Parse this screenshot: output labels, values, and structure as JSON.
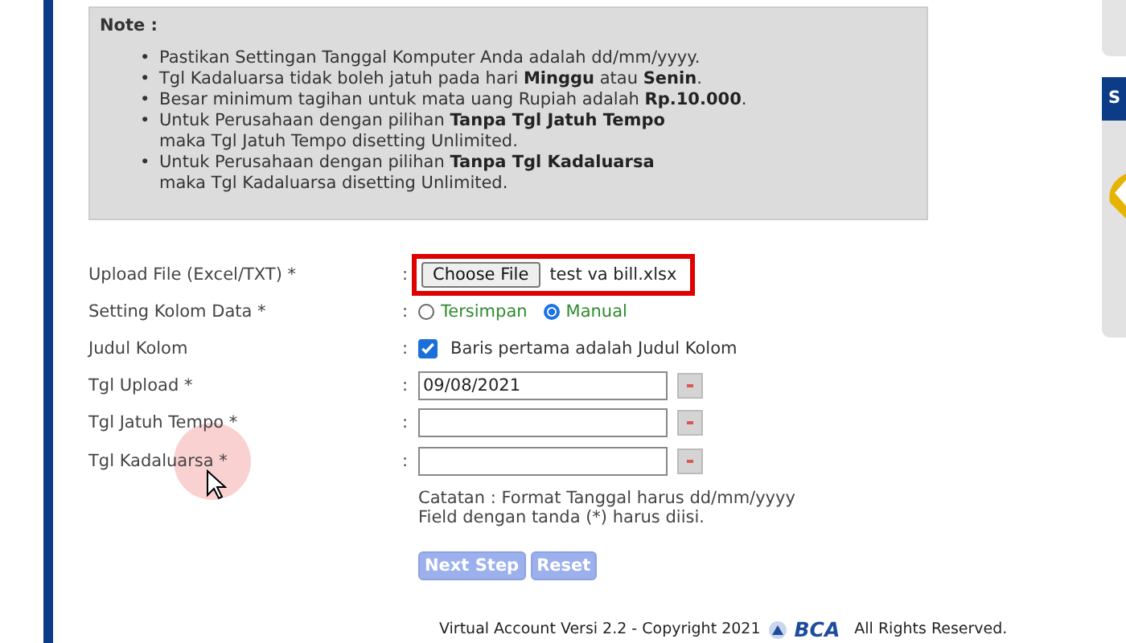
{
  "note": {
    "title": "Note :",
    "bullet": "•",
    "items": [
      {
        "text": "Pastikan Settingan Tanggal Komputer Anda adalah dd/mm/yyyy."
      },
      {
        "text": "Tgl Kadaluarsa tidak boleh jatuh pada hari **Minggu** atau **Senin**."
      },
      {
        "text": "Besar minimum tagihan untuk mata uang Rupiah adalah **Rp.10.000**."
      },
      {
        "text": "Untuk Perusahaan dengan pilihan **Tanpa Tgl Jatuh Tempo**",
        "continuation": "maka Tgl Jatuh Tempo disetting Unlimited."
      },
      {
        "text": "Untuk Perusahaan dengan pilihan **Tanpa Tgl Kadaluarsa**",
        "continuation": "maka Tgl Kadaluarsa disetting Unlimited."
      }
    ]
  },
  "form": [
    {
      "kind": "file",
      "label": "Upload File (Excel/TXT) *",
      "button": "Choose File",
      "file_name": "test va bill.xlsx",
      "highlighted": true
    },
    {
      "kind": "radio",
      "label": "Setting Kolom Data *",
      "options": [
        {
          "label": "Tersimpan",
          "selected": false
        },
        {
          "label": "Manual",
          "selected": true
        }
      ]
    },
    {
      "kind": "checkbox",
      "label": "Judul Kolom",
      "checked": true,
      "text": "Baris pertama adalah Judul Kolom"
    },
    {
      "kind": "date",
      "label": "Tgl Upload *",
      "value": "09/08/2021"
    },
    {
      "kind": "date",
      "label": "Tgl Jatuh Tempo *"
    },
    {
      "kind": "date",
      "label": "Tgl Kadaluarsa *"
    }
  ],
  "colon": ":",
  "hint": [
    "Catatan : Format Tanggal harus dd/mm/yyyy",
    "Field dengan tanda (*) harus diisi."
  ],
  "buttons": [
    "Next Step",
    "Reset"
  ],
  "footer": {
    "text": "Virtual Account Versi 2.2 - Copyright 2021",
    "logo": "BCA",
    "rights": "All Rights Reserved."
  },
  "side_panel": {
    "header": "S"
  }
}
